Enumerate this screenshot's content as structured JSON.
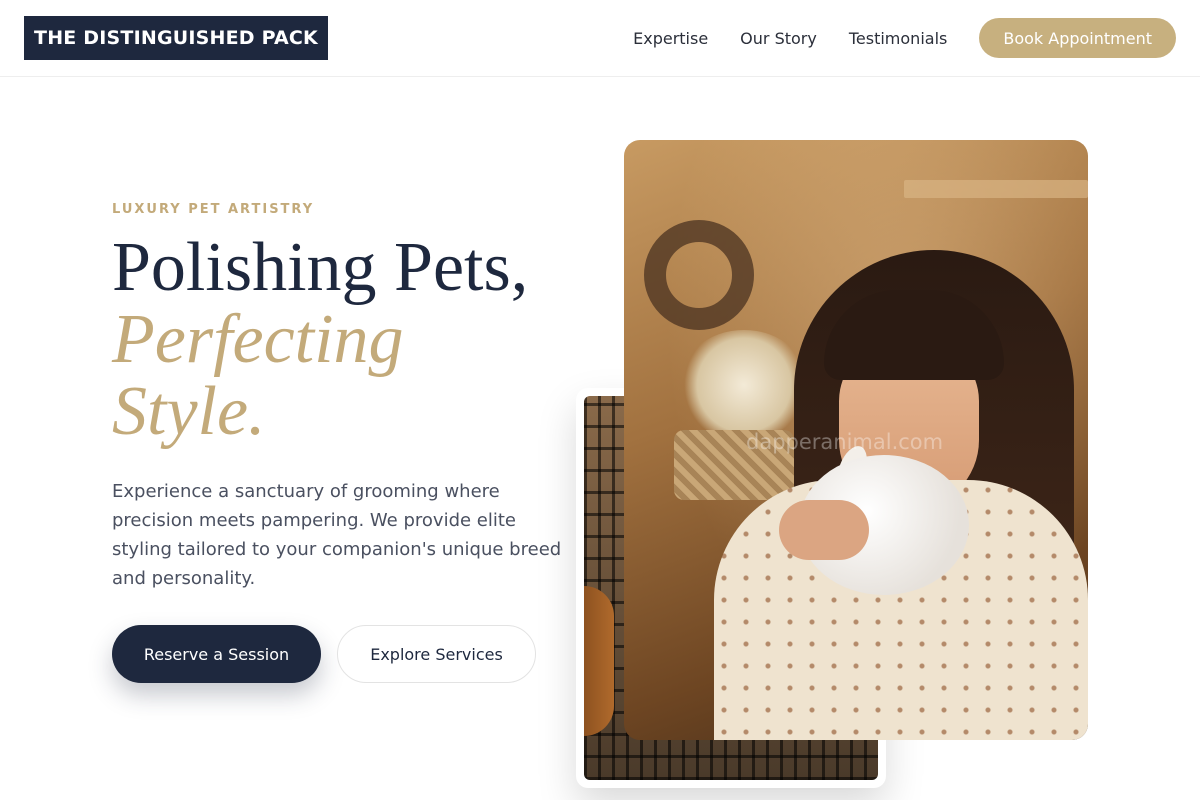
{
  "header": {
    "logo": "THE DISTINGUISHED PACK",
    "nav": [
      {
        "label": "Expertise"
      },
      {
        "label": "Our Story"
      },
      {
        "label": "Testimonials"
      }
    ],
    "cta": "Book Appointment"
  },
  "hero": {
    "eyebrow": "LUXURY PET ARTISTRY",
    "headline_line1": "Polishing Pets,",
    "headline_line2": "Perfecting",
    "headline_line3": "Style.",
    "lede": "Experience a sanctuary of grooming where precision meets pampering. We provide elite styling tailored to your companion's unique breed and personality.",
    "primary_button": "Reserve a Session",
    "secondary_button": "Explore Services"
  },
  "images": {
    "main_watermark": "dapperanimal.com"
  },
  "colors": {
    "navy": "#1e283e",
    "gold": "#c3aa7a",
    "cta_gold": "#c7b07f"
  }
}
